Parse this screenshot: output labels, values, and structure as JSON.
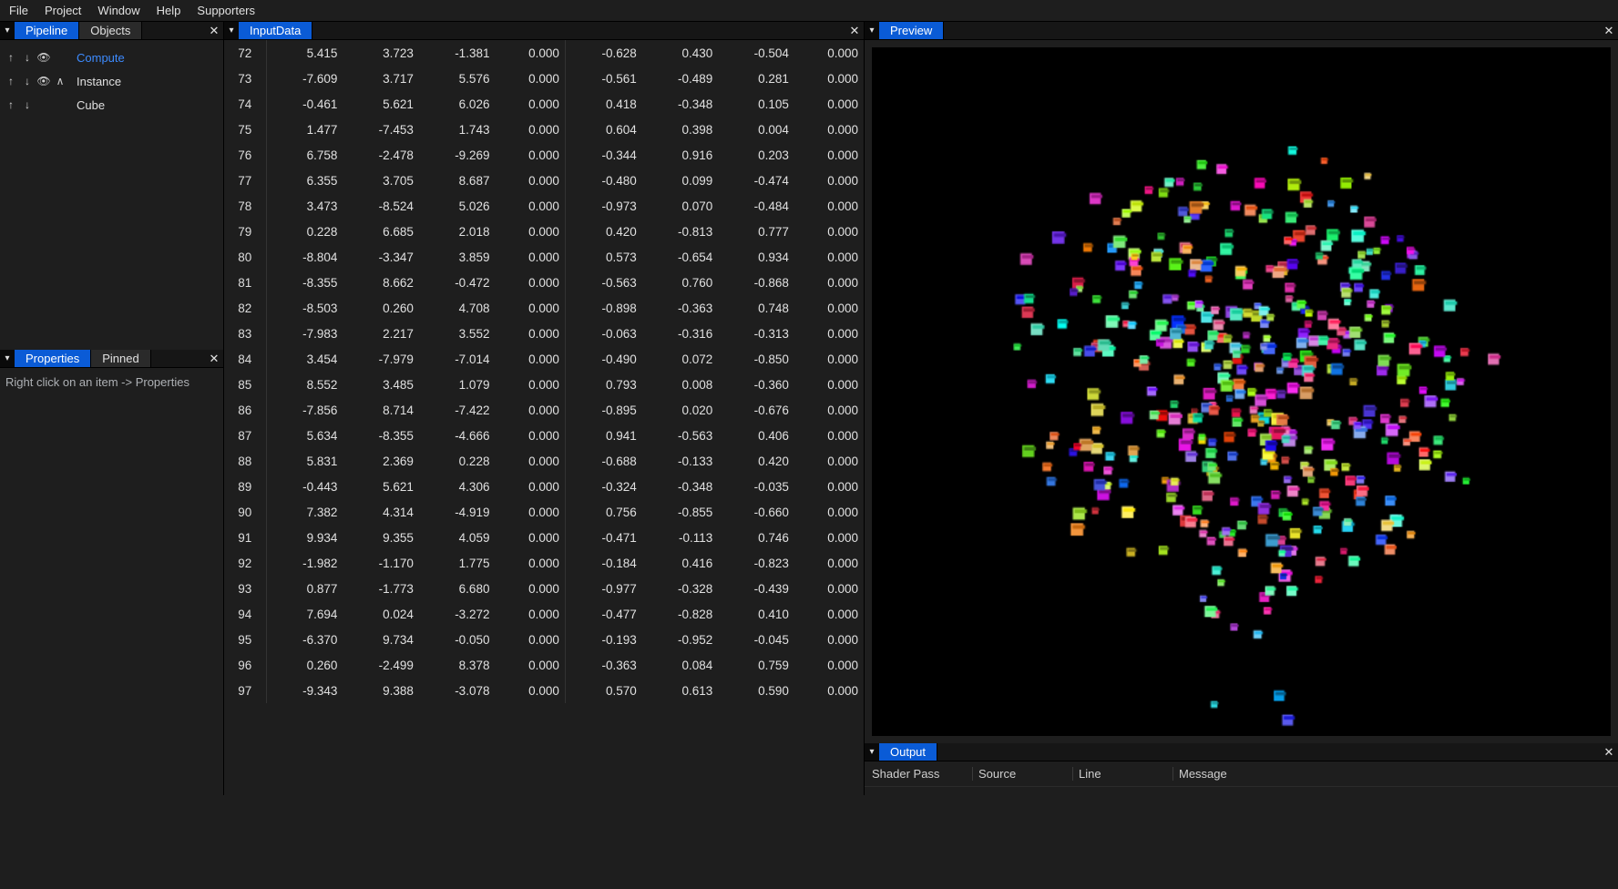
{
  "menu": {
    "items": [
      "File",
      "Project",
      "Window",
      "Help",
      "Supporters"
    ]
  },
  "left": {
    "pipeline": {
      "tabs": [
        "Pipeline",
        "Objects"
      ],
      "active_tab": 0,
      "tree": [
        {
          "up": true,
          "down": true,
          "eye": true,
          "caret": false,
          "label": "Compute",
          "selected": true
        },
        {
          "up": true,
          "down": true,
          "eye": true,
          "caret": true,
          "label": "Instance",
          "selected": false
        },
        {
          "up": true,
          "down": true,
          "eye": false,
          "caret": false,
          "label": "Cube",
          "selected": false
        }
      ]
    },
    "properties": {
      "tabs": [
        "Properties",
        "Pinned"
      ],
      "active_tab": 0,
      "hint": "Right click on an item -> Properties"
    }
  },
  "center": {
    "tabs": [
      "InputData"
    ],
    "active_tab": 0,
    "first_index": 72,
    "rows": [
      [
        5.415,
        3.723,
        -1.381,
        0.0,
        -0.628,
        0.43,
        -0.504,
        0.0
      ],
      [
        -7.609,
        3.717,
        5.576,
        0.0,
        -0.561,
        -0.489,
        0.281,
        0.0
      ],
      [
        -0.461,
        5.621,
        6.026,
        0.0,
        0.418,
        -0.348,
        0.105,
        0.0
      ],
      [
        1.477,
        -7.453,
        1.743,
        0.0,
        0.604,
        0.398,
        0.004,
        0.0
      ],
      [
        6.758,
        -2.478,
        -9.269,
        0.0,
        -0.344,
        0.916,
        0.203,
        0.0
      ],
      [
        6.355,
        3.705,
        8.687,
        0.0,
        -0.48,
        0.099,
        -0.474,
        0.0
      ],
      [
        3.473,
        -8.524,
        5.026,
        0.0,
        -0.973,
        0.07,
        -0.484,
        0.0
      ],
      [
        0.228,
        6.685,
        2.018,
        0.0,
        0.42,
        -0.813,
        0.777,
        0.0
      ],
      [
        -8.804,
        -3.347,
        3.859,
        0.0,
        0.573,
        -0.654,
        0.934,
        0.0
      ],
      [
        -8.355,
        8.662,
        -0.472,
        0.0,
        -0.563,
        0.76,
        -0.868,
        0.0
      ],
      [
        -8.503,
        0.26,
        4.708,
        0.0,
        -0.898,
        -0.363,
        0.748,
        0.0
      ],
      [
        -7.983,
        2.217,
        3.552,
        0.0,
        -0.063,
        -0.316,
        -0.313,
        0.0
      ],
      [
        3.454,
        -7.979,
        -7.014,
        0.0,
        -0.49,
        0.072,
        -0.85,
        0.0
      ],
      [
        8.552,
        3.485,
        1.079,
        0.0,
        0.793,
        0.008,
        -0.36,
        0.0
      ],
      [
        -7.856,
        8.714,
        -7.422,
        0.0,
        -0.895,
        0.02,
        -0.676,
        0.0
      ],
      [
        5.634,
        -8.355,
        -4.666,
        0.0,
        0.941,
        -0.563,
        0.406,
        0.0
      ],
      [
        5.831,
        2.369,
        0.228,
        0.0,
        -0.688,
        -0.133,
        0.42,
        0.0
      ],
      [
        -0.443,
        5.621,
        4.306,
        0.0,
        -0.324,
        -0.348,
        -0.035,
        0.0
      ],
      [
        7.382,
        4.314,
        -4.919,
        0.0,
        0.756,
        -0.855,
        -0.66,
        0.0
      ],
      [
        9.934,
        9.355,
        4.059,
        0.0,
        -0.471,
        -0.113,
        0.746,
        0.0
      ],
      [
        -1.982,
        -1.17,
        1.775,
        0.0,
        -0.184,
        0.416,
        -0.823,
        0.0
      ],
      [
        0.877,
        -1.773,
        6.68,
        0.0,
        -0.977,
        -0.328,
        -0.439,
        0.0
      ],
      [
        7.694,
        0.024,
        -3.272,
        0.0,
        -0.477,
        -0.828,
        0.41,
        0.0
      ],
      [
        -6.37,
        9.734,
        -0.05,
        0.0,
        -0.193,
        -0.952,
        -0.045,
        0.0
      ],
      [
        0.26,
        -2.499,
        8.378,
        0.0,
        -0.363,
        0.084,
        0.759,
        0.0
      ],
      [
        -9.343,
        9.388,
        -3.078,
        0.0,
        0.57,
        0.613,
        0.59,
        0.0
      ]
    ]
  },
  "right": {
    "preview_tab": "Preview",
    "output": {
      "tab": "Output",
      "columns": [
        "Shader Pass",
        "Source",
        "Line",
        "Message"
      ]
    }
  },
  "glyphs": {
    "dropdown": "▾",
    "up": "↑",
    "down": "↓",
    "eye": "👁",
    "caret": "∧",
    "close": "✕"
  },
  "colors": {
    "accent": "#0a5bd6",
    "link": "#3d8bff",
    "bg": "#1e1e1e",
    "canvas": "#000000"
  }
}
